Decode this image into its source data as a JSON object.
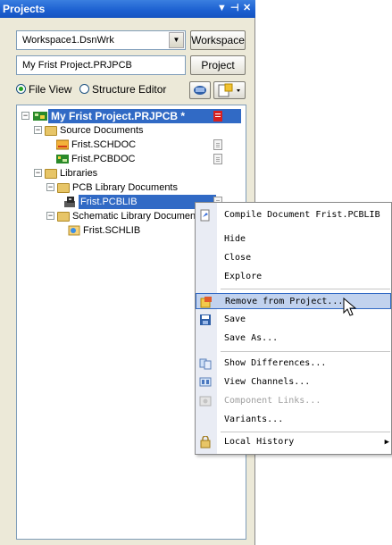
{
  "panel": {
    "title": "Projects",
    "workspace_combo_value": "Workspace1.DsnWrk",
    "workspace_button": "Workspace",
    "project_field_value": "My Frist Project.PRJPCB",
    "project_button": "Project",
    "view_options": [
      {
        "label": "File View",
        "selected": true
      },
      {
        "label": "Structure Editor",
        "selected": false
      }
    ]
  },
  "tree": {
    "project": "My Frist Project.PRJPCB *",
    "source_folder": "Source Documents",
    "schdoc": "Frist.SCHDOC",
    "pcbdoc": "Frist.PCBDOC",
    "libraries_folder": "Libraries",
    "pcb_lib_folder": "PCB Library Documents",
    "pcblib": "Frist.PCBLIB",
    "sch_lib_folder": "Schematic Library Documents",
    "schlib": "Frist.SCHLIB"
  },
  "menu": {
    "compile": "Compile Document Frist.PCBLIB",
    "hide": "Hide",
    "close": "Close",
    "explore": "Explore",
    "remove": "Remove from Project...",
    "save": "Save",
    "save_as": "Save As...",
    "show_differences": "Show Differences...",
    "view_channels": "View Channels...",
    "component_links": "Component Links...",
    "variants": "Variants...",
    "local_history": "Local History"
  },
  "colors": {
    "titlebar": "#1b5fd0",
    "selection": "#316ac5",
    "menu_highlight": "#c1d2ee"
  }
}
